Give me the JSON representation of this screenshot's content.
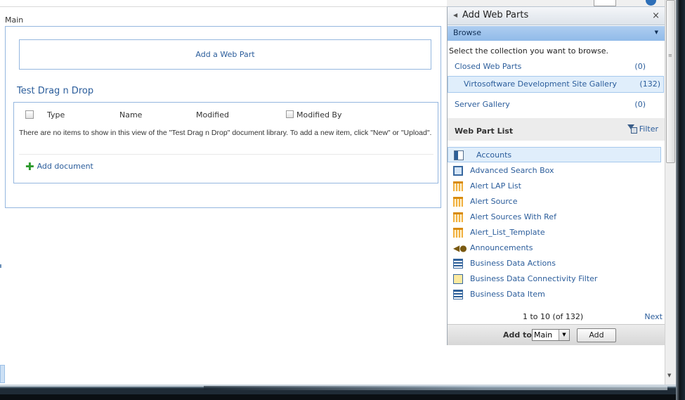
{
  "main": {
    "zone_label": "Main",
    "add_web_part": "Add a Web Part",
    "web_part_title": "Test Drag n Drop",
    "columns": [
      "Type",
      "Name",
      "Modified",
      "Modified By"
    ],
    "empty_message": "There are no items to show in this view of the \"Test Drag n Drop\" document library. To add a new item, click \"New\" or \"Upload\".",
    "add_document": "Add document"
  },
  "tool_pane": {
    "title": "Add Web Parts",
    "close_glyph": "×",
    "back_glyph": "◀",
    "browse_label": "Browse",
    "collection_prompt": "Select the collection you want to browse.",
    "collections": [
      {
        "name": "Closed Web Parts",
        "count": "(0)"
      },
      {
        "name": "Virtosoftware Development Site Gallery",
        "count": "(132)"
      },
      {
        "name": "Server Gallery",
        "count": "(0)"
      }
    ],
    "web_part_list_label": "Web Part List",
    "filter_label": "Filter",
    "web_parts": [
      {
        "label": "Accounts",
        "icon": "contact-card-icon"
      },
      {
        "label": "Advanced Search Box",
        "icon": "search-box-icon"
      },
      {
        "label": "Alert LAP List",
        "icon": "list-icon"
      },
      {
        "label": "Alert Source",
        "icon": "list-icon"
      },
      {
        "label": "Alert Sources With Ref",
        "icon": "list-icon"
      },
      {
        "label": "Alert_List_Template",
        "icon": "list-icon"
      },
      {
        "label": "Announcements",
        "icon": "megaphone-icon"
      },
      {
        "label": "Business Data Actions",
        "icon": "business-data-icon"
      },
      {
        "label": "Business Data Connectivity Filter",
        "icon": "filter-data-icon"
      },
      {
        "label": "Business Data Item",
        "icon": "business-data-icon"
      }
    ],
    "pager_range": "1 to 10 (of 132)",
    "pager_next": "Next",
    "add_to_label": "Add to:",
    "zone_selected": "Main",
    "add_button": "Add"
  },
  "colors": {
    "link_blue": "#2b5d9b",
    "browse_bar": "#91bbe9",
    "selected_bg": "#e0eefb",
    "zone_border": "#95b7df"
  }
}
